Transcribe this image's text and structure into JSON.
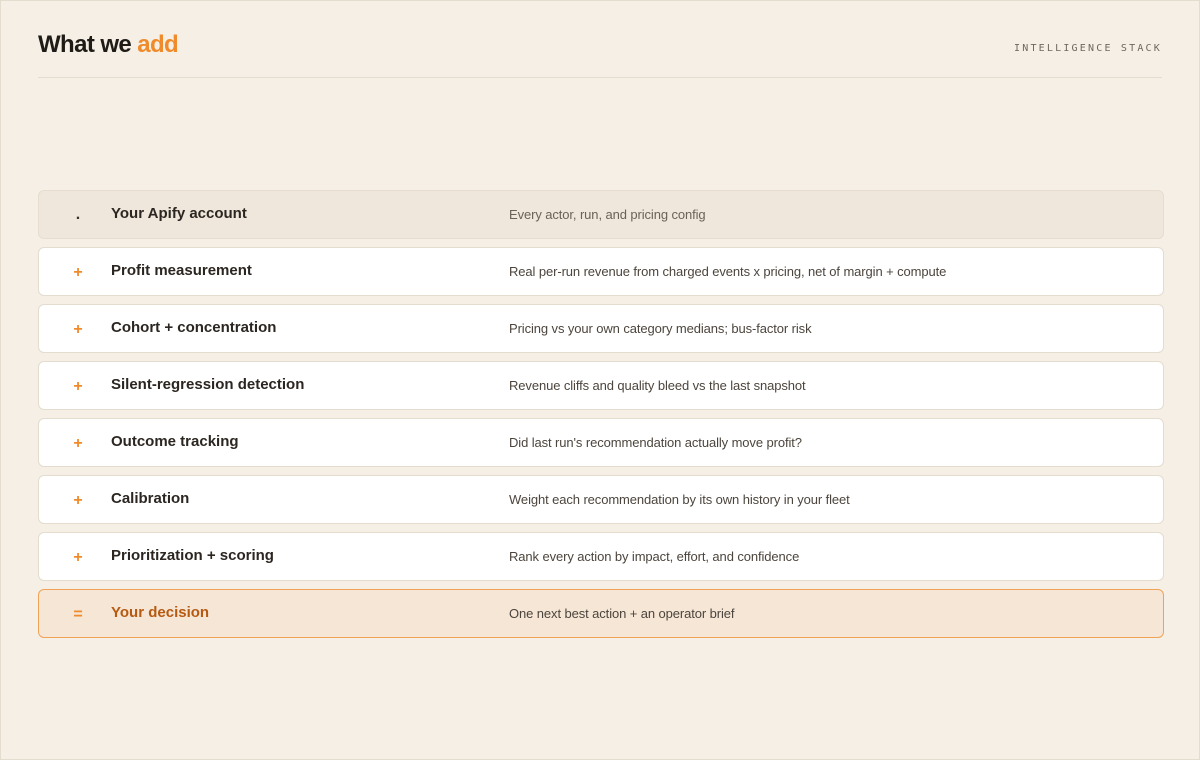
{
  "header": {
    "title_main": "What we",
    "title_accent": "add",
    "tag": "INTELLIGENCE STACK"
  },
  "colors": {
    "accent": "#f08b2c",
    "result_text": "#b65a12",
    "background": "#f5efe5"
  },
  "stack": [
    {
      "symbol": ".",
      "label": "Your Apify account",
      "description": "Every actor, run, and pricing config"
    },
    {
      "symbol": "+",
      "label": "Profit measurement",
      "description": "Real per-run revenue from charged events x pricing, net of margin + compute"
    },
    {
      "symbol": "+",
      "label": "Cohort + concentration",
      "description": "Pricing vs your own category medians; bus-factor risk"
    },
    {
      "symbol": "+",
      "label": "Silent-regression detection",
      "description": "Revenue cliffs and quality bleed vs the last snapshot"
    },
    {
      "symbol": "+",
      "label": "Outcome tracking",
      "description": "Did last run's recommendation actually move profit?"
    },
    {
      "symbol": "+",
      "label": "Calibration",
      "description": "Weight each recommendation by its own history in your fleet"
    },
    {
      "symbol": "+",
      "label": "Prioritization + scoring",
      "description": "Rank every action by impact, effort, and confidence"
    },
    {
      "symbol": "=",
      "label": "Your decision",
      "description": "One next best action + an operator brief"
    }
  ]
}
